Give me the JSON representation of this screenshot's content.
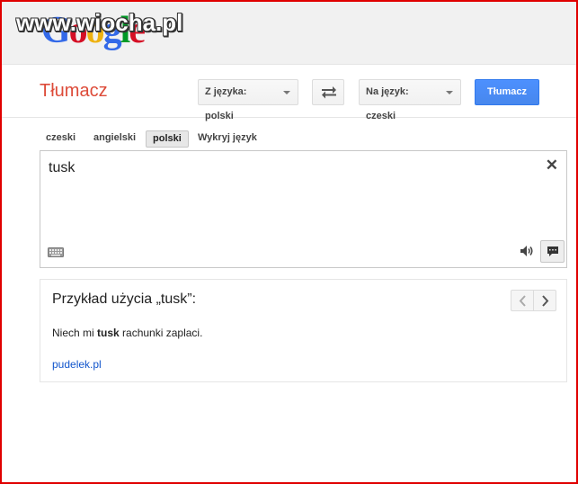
{
  "branding": {
    "logo_letters": [
      "G",
      "o",
      "o",
      "g",
      "l",
      "e"
    ],
    "logo_colors": [
      "#3369e8",
      "#d50f25",
      "#eeb211",
      "#3369e8",
      "#009925",
      "#d50f25"
    ],
    "watermark": "www.wiocha.pl"
  },
  "toolbar": {
    "app_title": "Tłumacz",
    "from_label": "Z języka: polski",
    "to_label": "Na język: czeski",
    "swap_icon": "swap-arrows-icon",
    "translate_label": "Tłumacz"
  },
  "language_tabs": [
    {
      "label": "czeski",
      "selected": false
    },
    {
      "label": "angielski",
      "selected": false
    },
    {
      "label": "polski",
      "selected": true
    },
    {
      "label": "Wykryj język",
      "selected": false
    }
  ],
  "source": {
    "text": "tusk",
    "clear_icon": "close-icon",
    "keyboard_icon": "keyboard-icon",
    "speaker_icon": "speaker-icon",
    "comment_icon": "comment-icon"
  },
  "example": {
    "title": "Przykład użycia „tusk”:",
    "sentence_before": "Niech mi ",
    "sentence_bold": "tusk",
    "sentence_after": " rachunki zaplaci.",
    "source_link": "pudelek.pl"
  },
  "colors": {
    "accent_red": "#dd4b39",
    "button_blue": "#4d90fe",
    "link_blue": "#1155cc",
    "frame_red": "#e00000"
  }
}
